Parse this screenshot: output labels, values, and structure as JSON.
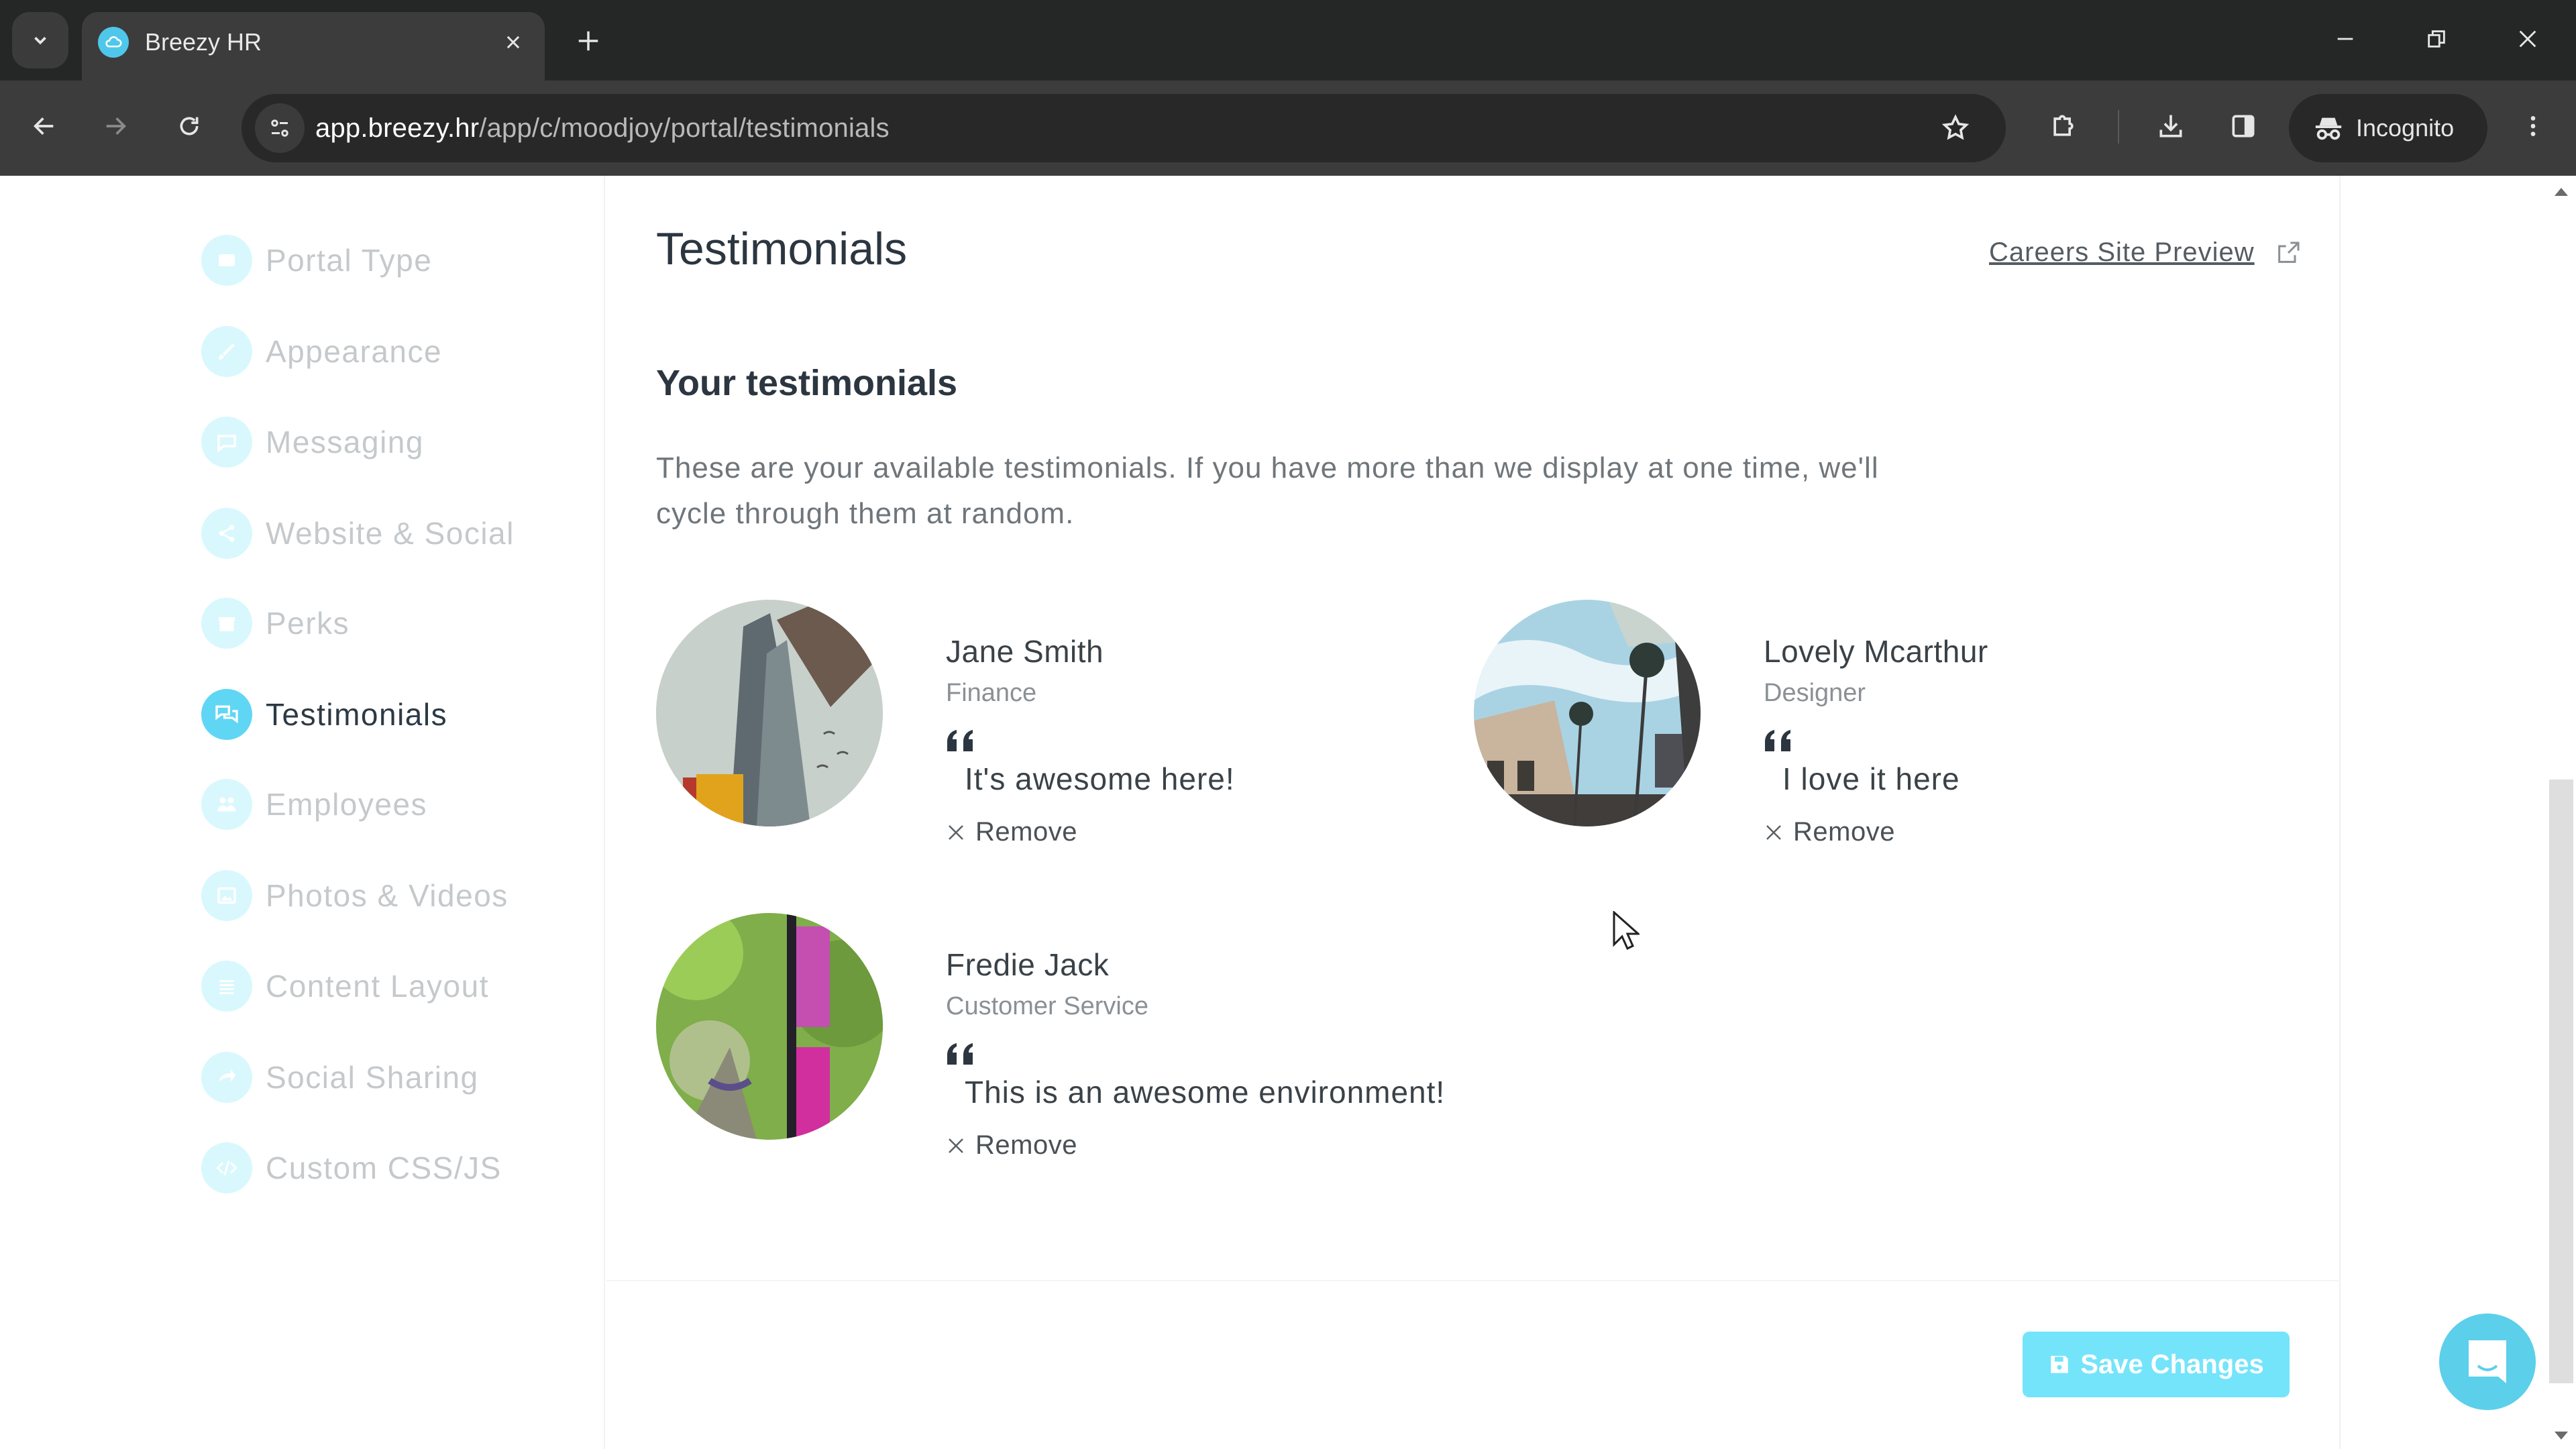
{
  "browser": {
    "tab_title": "Breezy HR",
    "url_host": "app.breezy.hr",
    "url_path": "/app/c/moodjoy/portal/testimonials",
    "profile_label": "Incognito",
    "icons": {
      "tab_search": "chevron-down-icon",
      "favicon": "breezy-cloud-icon",
      "tab_close": "close-icon",
      "new_tab": "plus-icon",
      "back": "arrow-left-icon",
      "forward": "arrow-right-icon",
      "reload": "reload-icon",
      "site_info": "tune-icon",
      "bookmark": "star-icon",
      "extensions": "puzzle-icon",
      "downloads": "download-icon",
      "side_panel": "side-panel-icon",
      "incognito": "incognito-icon",
      "menu": "more-vert-icon",
      "minimize": "minimize-icon",
      "restore": "restore-icon",
      "close_window": "close-icon"
    }
  },
  "sidebar": {
    "items": [
      {
        "label": "Portal Type",
        "icon": "portal-type-icon",
        "active": false
      },
      {
        "label": "Appearance",
        "icon": "brush-icon",
        "active": false
      },
      {
        "label": "Messaging",
        "icon": "chat-bubble-icon",
        "active": false
      },
      {
        "label": "Website & Social",
        "icon": "share-icon",
        "active": false
      },
      {
        "label": "Perks",
        "icon": "gift-icon",
        "active": false
      },
      {
        "label": "Testimonials",
        "icon": "testimonials-icon",
        "active": true
      },
      {
        "label": "Employees",
        "icon": "employees-icon",
        "active": false
      },
      {
        "label": "Photos & Videos",
        "icon": "photo-icon",
        "active": false
      },
      {
        "label": "Content Layout",
        "icon": "layout-icon",
        "active": false
      },
      {
        "label": "Social Sharing",
        "icon": "social-sharing-icon",
        "active": false
      },
      {
        "label": "Custom CSS/JS",
        "icon": "code-icon",
        "active": false
      }
    ]
  },
  "main": {
    "title": "Testimonials",
    "careers_link": "Careers Site Preview",
    "section_title": "Your testimonials",
    "section_desc": "These are your available testimonials. If you have more than we display at one time, we'll cycle through them at random.",
    "remove_label": "Remove",
    "testimonials": [
      {
        "name": "Jane Smith",
        "role": "Finance",
        "quote": "It's awesome here!",
        "photo": "steel-tower-with-birds"
      },
      {
        "name": "Lovely Mcarthur",
        "role": "Designer",
        "quote": "I love it here",
        "photo": "palm-trees-street"
      },
      {
        "name": "Fredie Jack",
        "role": "Customer Service",
        "quote": "This is an awesome environment!",
        "photo": "forest-shrine-sign"
      }
    ],
    "save_label": "Save Changes"
  },
  "colors": {
    "accent": "#60d6f5",
    "accent_light": "#d8f8fd",
    "save_button": "#74e4fb",
    "chat_launcher": "#5ccfea",
    "text_dark": "#2c3640",
    "text_muted": "#6f767b"
  }
}
